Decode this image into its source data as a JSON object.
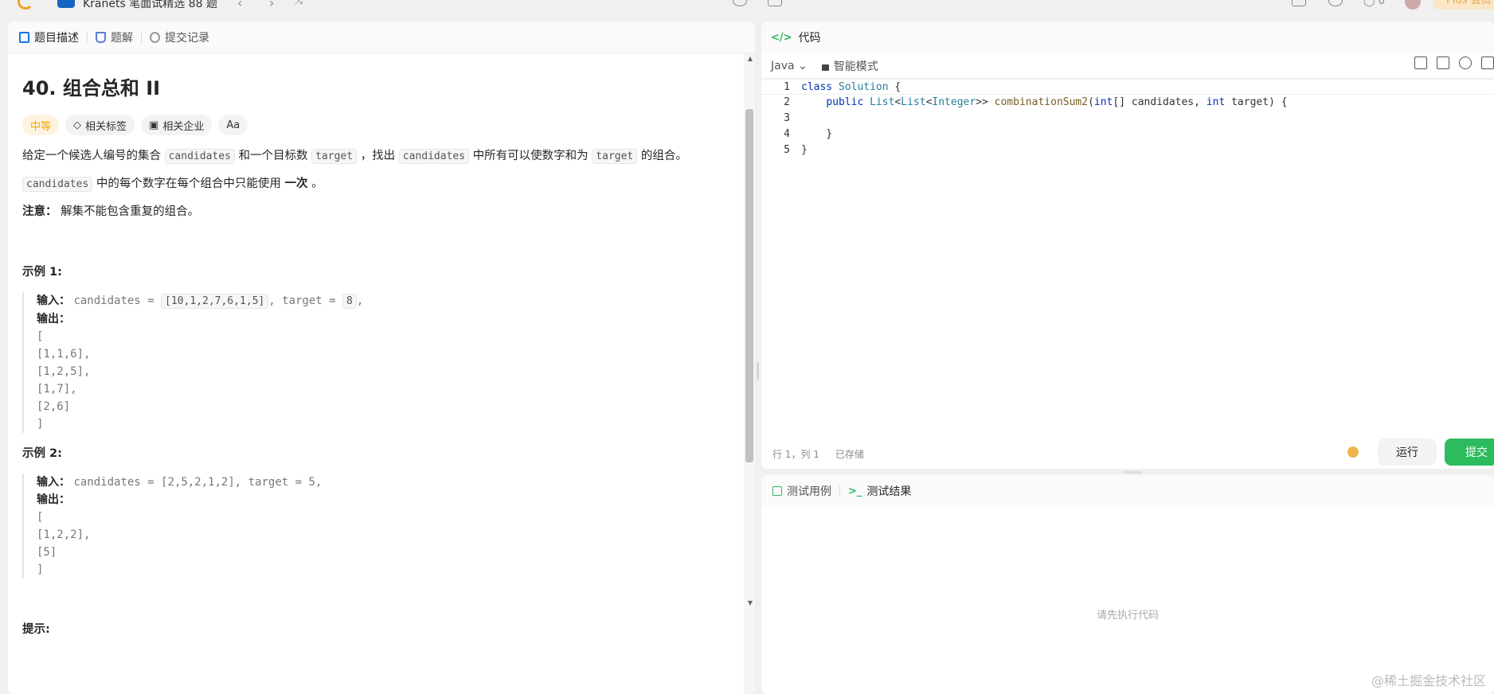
{
  "topbar": {
    "title": "Kranets 笔面试精选 88 题",
    "plus_label": "Plus 会员",
    "counter": "0"
  },
  "left": {
    "tabs": [
      {
        "label": "题目描述",
        "icon": "doc-icon"
      },
      {
        "label": "题解",
        "icon": "flask-icon"
      },
      {
        "label": "提交记录",
        "icon": "history-icon"
      }
    ],
    "question": {
      "title": "40. 组合总和 II",
      "difficulty": "中等",
      "tag_related": "相关标签",
      "tag_company": "相关企业",
      "tag_font": "Aa",
      "desc_part1": "给定一个候选人编号的集合",
      "code_candidates": "candidates",
      "desc_part2": "和一个目标数",
      "code_target": "target",
      "desc_part3": "，找出",
      "desc_part4": "中所有可以使数字和为",
      "desc_part5": "的组合。",
      "p2_code": "candidates",
      "p2_text": "中的每个数字在每个组合中只能使用",
      "p2_bold": "一次",
      "p2_end": "。",
      "note_label": "注意：",
      "note_text": "解集不能包含重复的组合。"
    },
    "example1": {
      "title": "示例 1:",
      "input_label": "输入：",
      "input_prefix": "candidates = ",
      "input_array": "[10,1,2,7,6,1,5]",
      "input_mid": ", target = ",
      "input_target": "8",
      "input_end": ",",
      "output_label": "输出：",
      "output_lines": [
        "[",
        "[1,1,6],",
        "[1,2,5],",
        "[1,7],",
        "[2,6]",
        "]"
      ]
    },
    "example2": {
      "title": "示例 2:",
      "input_label": "输入：",
      "input_value": "candidates = [2,5,2,1,2], target = 5,",
      "output_label": "输出：",
      "output_lines": [
        "[",
        "[1,2,2],",
        "[5]",
        "]"
      ]
    },
    "hints_title": "提示:"
  },
  "editor": {
    "header": "代码",
    "language": "Java",
    "mode": "智能模式",
    "status_pos": "行 1，列 1",
    "status_saved": "已存储",
    "run_label": "运行",
    "submit_label": "提交",
    "line_numbers": [
      "1",
      "2",
      "3",
      "4",
      "5"
    ]
  },
  "result": {
    "tab_testcase": "测试用例",
    "tab_result": "测试结果",
    "placeholder": "请先执行代码"
  },
  "watermark": "@稀土掘金技术社区"
}
